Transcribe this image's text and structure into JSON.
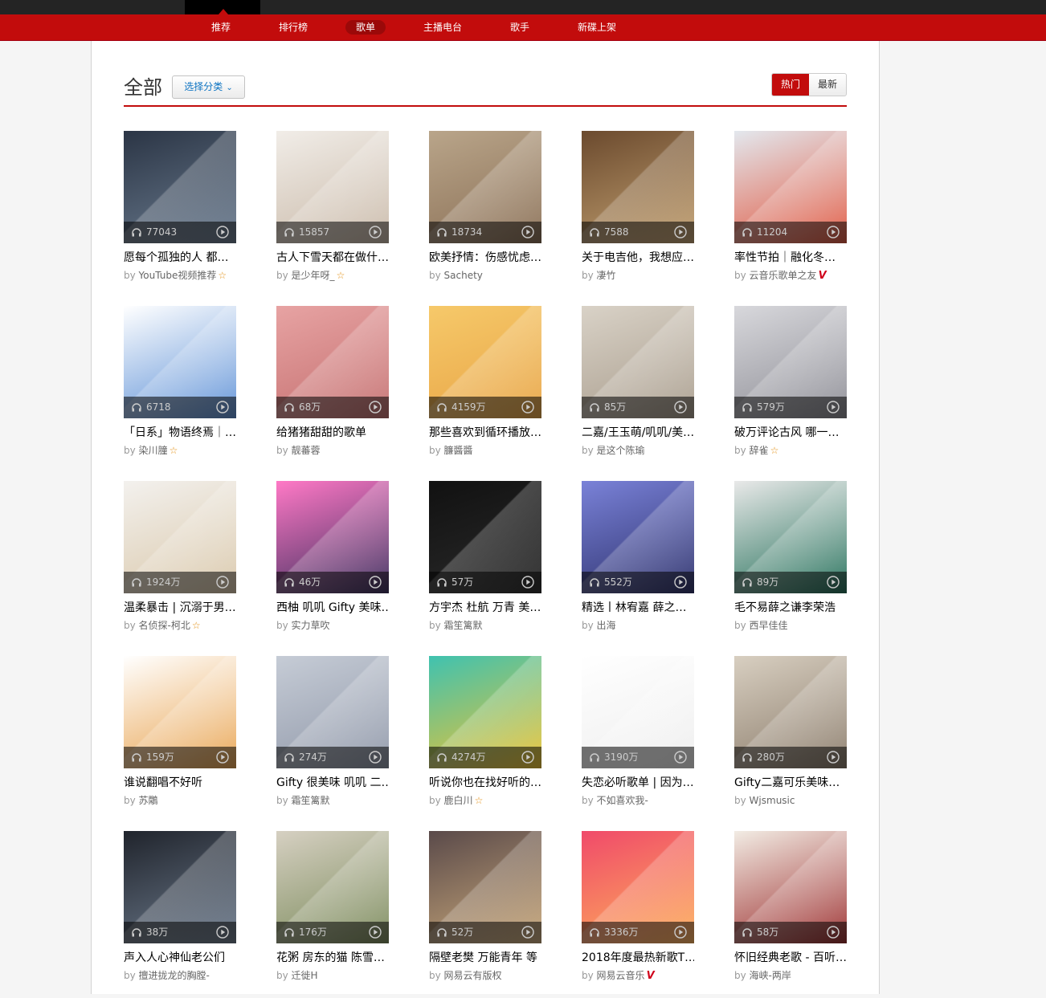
{
  "nav": {
    "items": [
      "推荐",
      "排行榜",
      "歌单",
      "主播电台",
      "歌手",
      "新碟上架"
    ],
    "active_index": 2
  },
  "header": {
    "title": "全部",
    "category_button": "选择分类",
    "sort_hot": "热门",
    "sort_new": "最新"
  },
  "colors": {
    "accent": "#C20C0C",
    "star": "#e39015",
    "vip": "#d0021b",
    "link": "#0c73c2"
  },
  "playlists": [
    {
      "plays": "77043",
      "title": "愿每个孤独的人 都…",
      "author": "YouTube视频推荐",
      "badge": "star",
      "cover": [
        "#2b3545",
        "#6a7b8f"
      ]
    },
    {
      "plays": "15857",
      "title": "古人下雪天都在做什…",
      "author": "是少年呀_",
      "badge": "star",
      "cover": [
        "#f1ede8",
        "#c9b9a8"
      ]
    },
    {
      "plays": "18734",
      "title": "欧美抒情：伤感忧虑…",
      "author": "Sachety",
      "badge": "",
      "cover": [
        "#b9a58a",
        "#8a6f55"
      ]
    },
    {
      "plays": "7588",
      "title": "关于电吉他，我想应…",
      "author": "凄竹",
      "badge": "",
      "cover": [
        "#6b4a2e",
        "#c2a070"
      ]
    },
    {
      "plays": "11204",
      "title": "率性节拍｜融化冬…",
      "author": "云音乐歌单之友",
      "badge": "vip",
      "cover": [
        "#e3e8ee",
        "#e0553d"
      ]
    },
    {
      "plays": "6718",
      "title": "「日系」物语终焉｜…",
      "author": "染川膧",
      "badge": "star",
      "cover": [
        "#ffffff",
        "#5b8fd6"
      ]
    },
    {
      "plays": "68万",
      "title": "给猪猪甜甜的歌单",
      "author": "靓蕃蓉",
      "badge": "",
      "cover": [
        "#e7a3a3",
        "#c46f6f"
      ]
    },
    {
      "plays": "4159万",
      "title": "那些喜欢到循环播放…",
      "author": "臁醬醬",
      "badge": "",
      "cover": [
        "#f6c96a",
        "#e8a445"
      ]
    },
    {
      "plays": "85万",
      "title": "二嘉/王玉萌/叽叽/美…",
      "author": "是这个陈瑜",
      "badge": "",
      "cover": [
        "#d9d2c7",
        "#a89c8c"
      ]
    },
    {
      "plays": "579万",
      "title": "破万评论古风 哪一…",
      "author": "辞雀",
      "badge": "star",
      "cover": [
        "#d8d8dc",
        "#8c8c94"
      ]
    },
    {
      "plays": "1924万",
      "title": "温柔暴击 | 沉溺于男…",
      "author": "名侦探-柯北",
      "badge": "star",
      "cover": [
        "#f3f1ee",
        "#d9c7a9"
      ]
    },
    {
      "plays": "46万",
      "title": "西柚 叽叽 Gifty 美味…",
      "author": "实力草吹",
      "badge": "",
      "cover": [
        "#ff79c6",
        "#3a2d5c"
      ]
    },
    {
      "plays": "57万",
      "title": "方宇杰 杜航 万青 美…",
      "author": "霜笙篱默",
      "badge": "",
      "cover": [
        "#111111",
        "#2a2a2a"
      ]
    },
    {
      "plays": "552万",
      "title": "精选丨林宥嘉 薛之…",
      "author": "出海",
      "badge": "",
      "cover": [
        "#7a82d8",
        "#2b2f6a"
      ]
    },
    {
      "plays": "89万",
      "title": "毛不易薛之谦李荣浩",
      "author": "西早佳佳",
      "badge": "",
      "cover": [
        "#e9e9e9",
        "#1f6d56"
      ]
    },
    {
      "plays": "159万",
      "title": "谁说翻唱不好听",
      "author": "苏鷴",
      "badge": "",
      "cover": [
        "#ffffff",
        "#e8a24d"
      ]
    },
    {
      "plays": "274万",
      "title": "Gifty 很美味 叽叽 二…",
      "author": "霜笙篱默",
      "badge": "",
      "cover": [
        "#c6ccd6",
        "#8f97a8"
      ]
    },
    {
      "plays": "4274万",
      "title": "听说你也在找好听的…",
      "author": "鹿白川",
      "badge": "star",
      "cover": [
        "#3fc2b0",
        "#f0c330"
      ]
    },
    {
      "plays": "3190万",
      "title": "失恋必听歌单 | 因为…",
      "author": "不如喜欢我-",
      "badge": "",
      "cover": [
        "#ffffff",
        "#eeeeee"
      ]
    },
    {
      "plays": "280万",
      "title": "Gifty二嘉可乐美味…",
      "author": "Wjsmusic",
      "badge": "",
      "cover": [
        "#d8cfc1",
        "#8a7b6a"
      ]
    },
    {
      "plays": "38万",
      "title": "声入人心神仙老公们",
      "author": "擅进拢龙的胸膛-",
      "badge": "",
      "cover": [
        "#20242c",
        "#6c7a8c"
      ]
    },
    {
      "plays": "176万",
      "title": "花粥 房东的猫 陈雪…",
      "author": "迁徙H",
      "badge": "",
      "cover": [
        "#d6d0c2",
        "#7a8a5a"
      ]
    },
    {
      "plays": "52万",
      "title": "隔壁老樊 万能青年 等",
      "author": "网易云有版权",
      "badge": "",
      "cover": [
        "#5a4a4a",
        "#c9a87a"
      ]
    },
    {
      "plays": "3336万",
      "title": "2018年度最热新歌T…",
      "author": "网易云音乐",
      "badge": "vip",
      "cover": [
        "#f04a6a",
        "#fdb05a"
      ]
    },
    {
      "plays": "58万",
      "title": "怀旧经典老歌 - 百听…",
      "author": "海峡-两岸",
      "badge": "",
      "cover": [
        "#f2ece4",
        "#9a2a2a"
      ]
    }
  ]
}
